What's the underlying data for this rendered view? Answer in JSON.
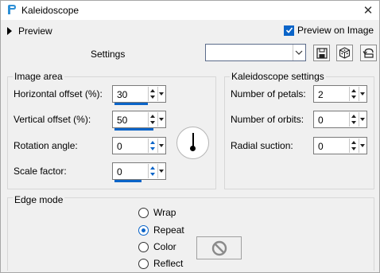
{
  "window": {
    "title": "Kaleidoscope",
    "app_icon": "app-icon",
    "close_glyph": "✕"
  },
  "preview": {
    "label": "Preview",
    "on_image_label": "Preview on Image",
    "on_image_checked": true
  },
  "settings": {
    "label": "Settings",
    "selected_value": ""
  },
  "toolbar": {
    "icons": [
      "save-icon",
      "randomize-icon",
      "reset-icon"
    ]
  },
  "image_area": {
    "title": "Image area",
    "fields": [
      {
        "label": "Horizontal offset (%):",
        "value": "30"
      },
      {
        "label": "Vertical offset (%):",
        "value": "50"
      },
      {
        "label": "Rotation angle:",
        "value": "0"
      },
      {
        "label": "Scale factor:",
        "value": "0"
      }
    ]
  },
  "kaleidoscope": {
    "title": "Kaleidoscope settings",
    "fields": [
      {
        "label": "Number of petals:",
        "value": "2"
      },
      {
        "label": "Number of orbits:",
        "value": "0"
      },
      {
        "label": "Radial suction:",
        "value": "0"
      }
    ]
  },
  "edge_mode": {
    "title": "Edge mode",
    "options": [
      {
        "label": "Wrap",
        "selected": false
      },
      {
        "label": "Repeat",
        "selected": true
      },
      {
        "label": "Color",
        "selected": false
      },
      {
        "label": "Reflect",
        "selected": false
      }
    ],
    "color_swatch_icon": "no-color-icon"
  },
  "colors": {
    "accent": "#0a64c8"
  }
}
